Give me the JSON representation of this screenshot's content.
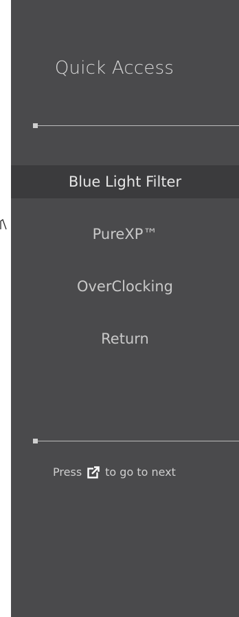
{
  "panel": {
    "title": "Quick Access"
  },
  "menu": {
    "items": [
      {
        "label": "Blue Light Filter",
        "selected": true
      },
      {
        "label": "PureXP™",
        "selected": false
      },
      {
        "label": "OverClocking",
        "selected": false
      },
      {
        "label": "Return",
        "selected": false
      }
    ]
  },
  "hint": {
    "before": "Press",
    "icon": "external-link-icon",
    "after": "to go to next"
  },
  "colors": {
    "panel_bg": "#4a4a4c",
    "selected_bg": "#3b3b3d",
    "text": "#c9c9c9"
  }
}
